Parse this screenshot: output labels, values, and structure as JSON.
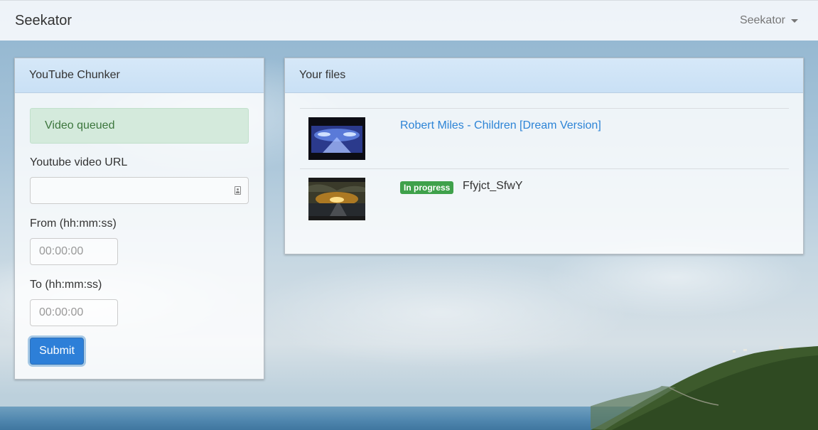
{
  "navbar": {
    "brand": "Seekator",
    "user_menu_label": "Seekator"
  },
  "chunker": {
    "title": "YouTube Chunker",
    "alert": "Video queued",
    "url_label": "Youtube video URL",
    "url_value": "",
    "from_label": "From (hh:mm:ss)",
    "from_placeholder": "00:00:00",
    "to_label": "To (hh:mm:ss)",
    "to_placeholder": "00:00:00",
    "submit_label": "Submit"
  },
  "files": {
    "title": "Your files",
    "items": [
      {
        "name": "Robert Miles - Children [Dream Version]",
        "status": ""
      },
      {
        "name": "Ffyjct_SfwY",
        "status": "In progress"
      }
    ]
  },
  "colors": {
    "primary": "#2d7fd8",
    "link": "#2d84d6",
    "success_badge": "#3fa14b",
    "alert_bg": "#d4eadc",
    "header_bg": "#cfe4f7"
  }
}
